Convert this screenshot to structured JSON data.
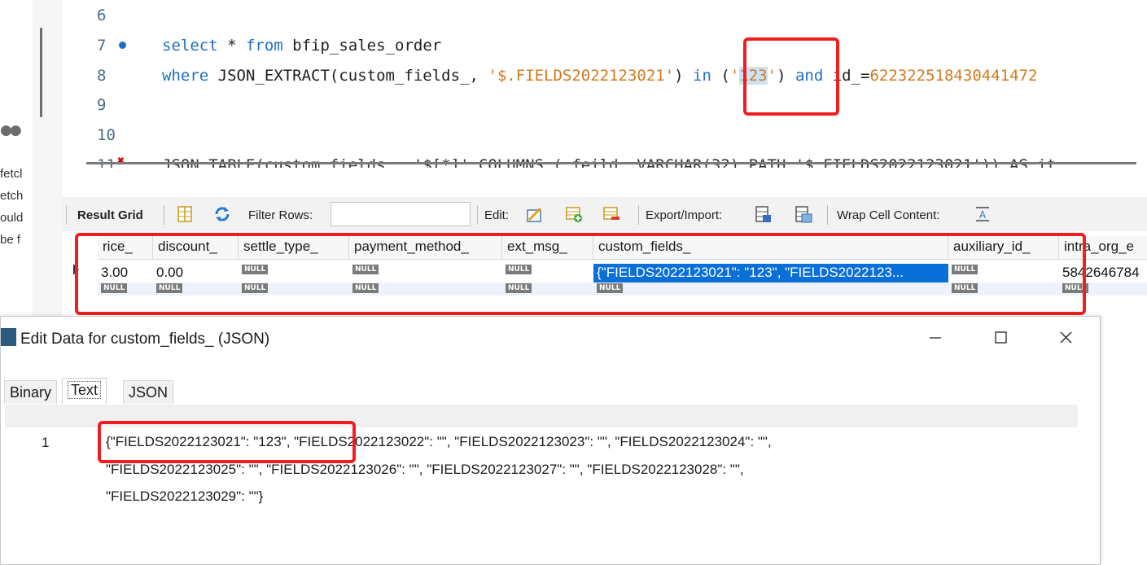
{
  "left_panel": {
    "fragments": [
      "fetcl",
      "etch",
      "ould",
      "be f"
    ]
  },
  "editor": {
    "lines": [
      {
        "num": "6",
        "text": ""
      },
      {
        "num": "7",
        "kw1": "select",
        "t1": " * ",
        "kw2": "from",
        "t2": " bfip_sales_order"
      },
      {
        "num": "8",
        "kw1": "where",
        "t1": " JSON_EXTRACT(custom_fields_, ",
        "str1": "'$.FIELDS2022123021'",
        "t2": ") ",
        "kw2": "in",
        "t3": " (",
        "str2a": "'",
        "str2b": "123",
        "str2c": "'",
        "t4": ") ",
        "kw3": "and",
        "t5": " id_=",
        "num1": "622322518430441472"
      },
      {
        "num": "9",
        "text": ""
      },
      {
        "num": "10",
        "text": ""
      },
      {
        "num": "11",
        "partial": "JSON_TABLE(custom_fields_, '$[*]' COLUMNS ( feild  VARCHAR(32) PATH '$.FIELDS2022123021')) AS it"
      }
    ]
  },
  "toolbar": {
    "result_grid": "Result Grid",
    "filter_rows": "Filter Rows:",
    "edit": "Edit:",
    "export_import": "Export/Import:",
    "wrap_cell": "Wrap Cell Content:"
  },
  "grid": {
    "columns": [
      "rice_",
      "discount_",
      "settle_type_",
      "payment_method_",
      "ext_msg_",
      "custom_fields_",
      "auxiliary_id_",
      "intra_org_e"
    ],
    "row1": [
      "3.00",
      "0.00",
      "NULL",
      "NULL",
      "NULL",
      "{\"FIELDS2022123021\": \"123\", \"FIELDS2022123...",
      "NULL",
      "5842646784"
    ],
    "row2": [
      "NULL",
      "NULL",
      "NULL",
      "NULL",
      "NULL",
      "NULL",
      "NULL",
      "NULL"
    ],
    "null_label": "NULL"
  },
  "dialog": {
    "title": "Edit Data for custom_fields_ (JSON)",
    "tabs": [
      "Binary",
      "Text",
      "JSON"
    ],
    "active_tab": "Text",
    "line_number": "1",
    "json_lines": [
      "{\"FIELDS2022123021\": \"123\", \"FIELDS2022123022\": \"\", \"FIELDS2022123023\": \"\", \"FIELDS2022123024\": \"\",",
      "\"FIELDS2022123025\": \"\", \"FIELDS2022123026\": \"\", \"FIELDS2022123027\": \"\", \"FIELDS2022123028\": \"\",",
      "\"FIELDS2022123029\": \"\"}"
    ]
  },
  "colors": {
    "highlight_box": "#f01e1e",
    "keyword": "#1f6fc4",
    "string": "#d47a1e",
    "selected_cell": "#0a6fd6"
  }
}
